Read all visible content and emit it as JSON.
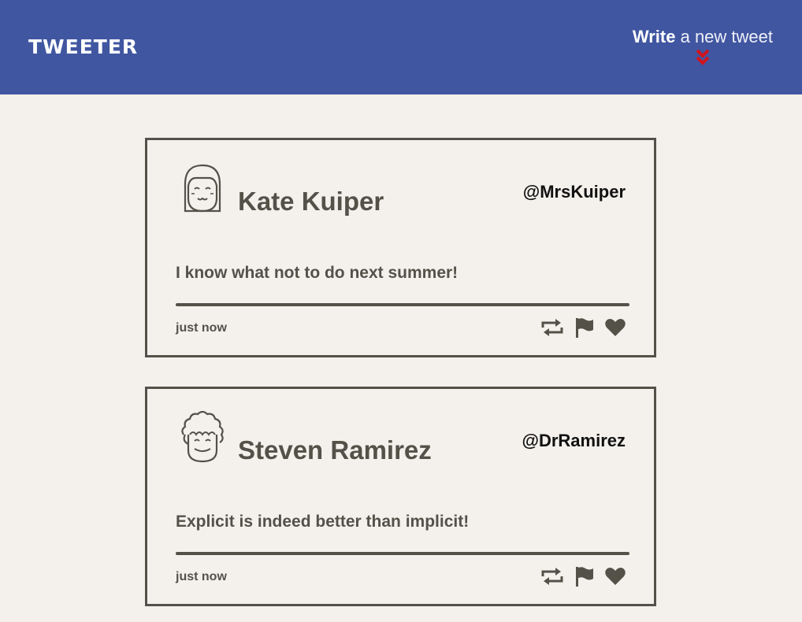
{
  "header": {
    "logo": "TWEETER",
    "compose_strong": "Write",
    "compose_rest": "a new tweet",
    "compose_icon": "double-chevron-down-icon",
    "colors": {
      "nav_background": "#4056a1",
      "page_background": "#f4f1ec",
      "chevron": "#d0141e",
      "text": "#545149"
    }
  },
  "tweets": [
    {
      "name": "Kate Kuiper",
      "handle": "@MrsKuiper",
      "content": "I know what not to do next summer!",
      "time": "just now",
      "avatar_icon": "girl-avatar-icon"
    },
    {
      "name": "Steven Ramirez",
      "handle": "@DrRamirez",
      "content": "Explicit is indeed better than implicit!",
      "time": "just now",
      "avatar_icon": "curly-hair-avatar-icon"
    }
  ],
  "actions": [
    "retweet-icon",
    "flag-icon",
    "heart-icon"
  ]
}
